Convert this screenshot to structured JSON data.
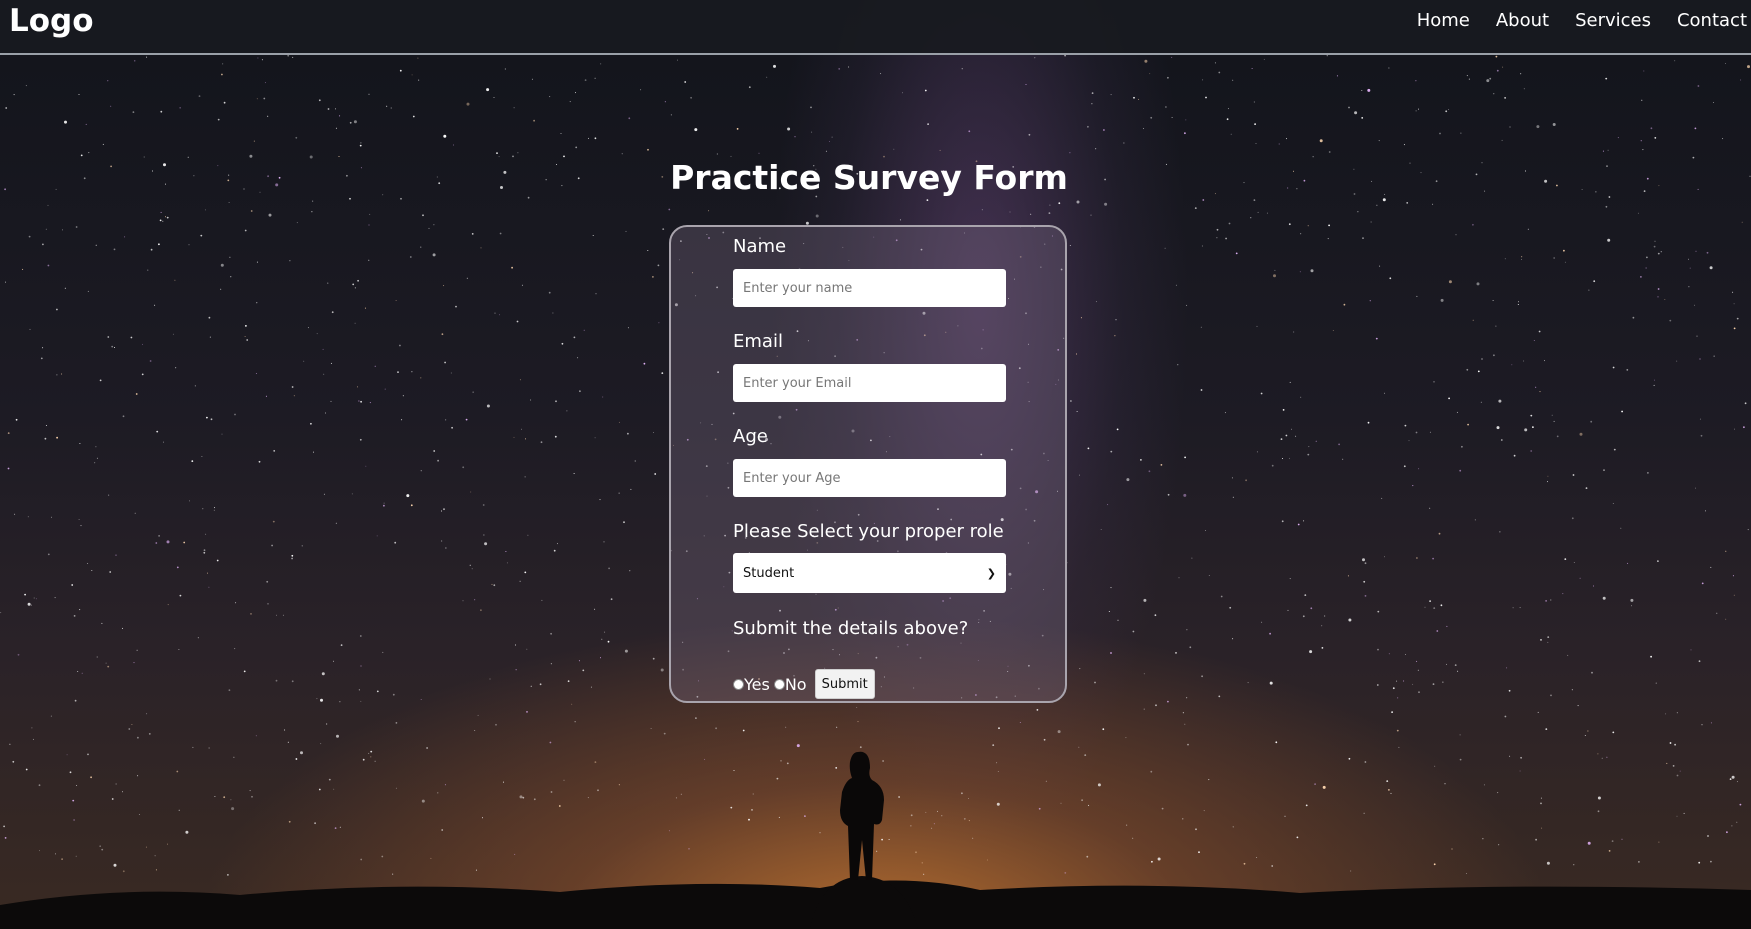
{
  "header": {
    "logo": "Logo",
    "nav": [
      "Home",
      "About",
      "Services",
      "Contact"
    ]
  },
  "form": {
    "title": "Practice Survey Form",
    "name_label": "Name",
    "name_placeholder": "Enter your name",
    "email_label": "Email",
    "email_placeholder": "Enter your Email",
    "age_label": "Age",
    "age_placeholder": "Enter your Age",
    "role_label": "Please Select your proper role",
    "role_selected": "Student",
    "submit_question": "Submit the details above?",
    "radio_yes": "Yes",
    "radio_no": "No",
    "submit_label": "Submit"
  },
  "colors": {
    "navbar": "#181a20",
    "text": "#ffffff"
  }
}
